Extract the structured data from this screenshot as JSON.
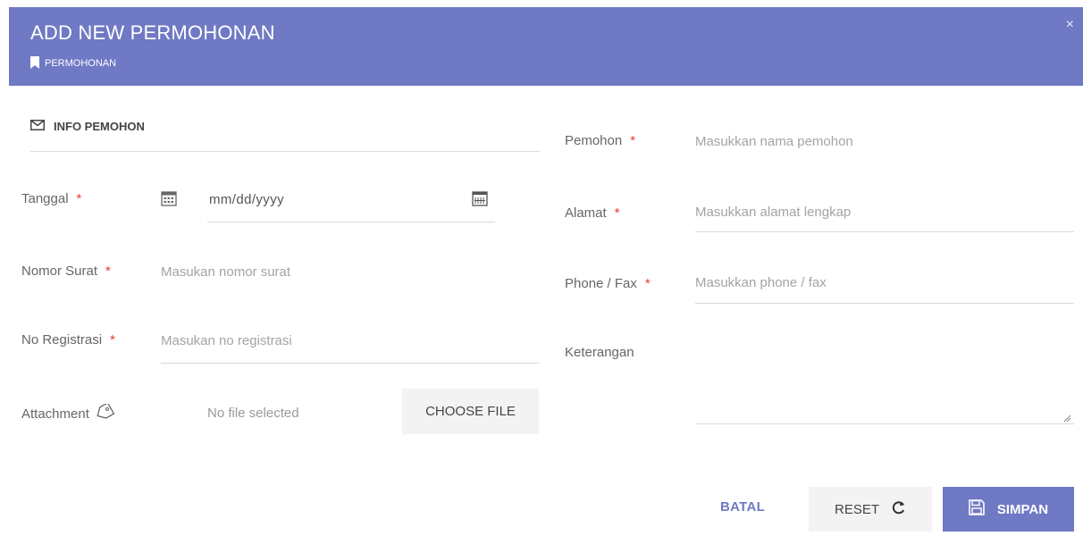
{
  "header": {
    "title": "ADD NEW PERMOHONAN",
    "breadcrumb": "PERMOHONAN",
    "close_label": "×"
  },
  "section": {
    "title": "INFO PEMOHON"
  },
  "required_marker": "*",
  "fields": {
    "tanggal": {
      "label": "Tanggal",
      "value": "mm/dd/yyyy"
    },
    "nomor_surat": {
      "label": "Nomor Surat",
      "placeholder": "Masukan nomor surat"
    },
    "no_registrasi": {
      "label": "No Registrasi",
      "placeholder": "Masukan no registrasi"
    },
    "attachment": {
      "label": "Attachment",
      "file_status": "No file selected",
      "button_label": "CHOOSE FILE"
    },
    "pemohon": {
      "label": "Pemohon",
      "placeholder": "Masukkan nama pemohon"
    },
    "alamat": {
      "label": "Alamat",
      "placeholder": "Masukkan alamat lengkap"
    },
    "phone_fax": {
      "label": "Phone / Fax",
      "placeholder": "Masukkan phone / fax"
    },
    "keterangan": {
      "label": "Keterangan",
      "placeholder": ""
    }
  },
  "actions": {
    "batal": "BATAL",
    "reset": "RESET",
    "simpan": "SIMPAN"
  },
  "colors": {
    "primary": "#6f79c4",
    "required": "#e53935",
    "button_gray": "#f3f3f3"
  },
  "icons": [
    "bookmark-icon",
    "envelope-icon",
    "calendar-icon",
    "calendar-picker-icon",
    "tag-icon",
    "refresh-icon",
    "floppy-disk-icon",
    "close-icon",
    "resize-grip-icon"
  ]
}
